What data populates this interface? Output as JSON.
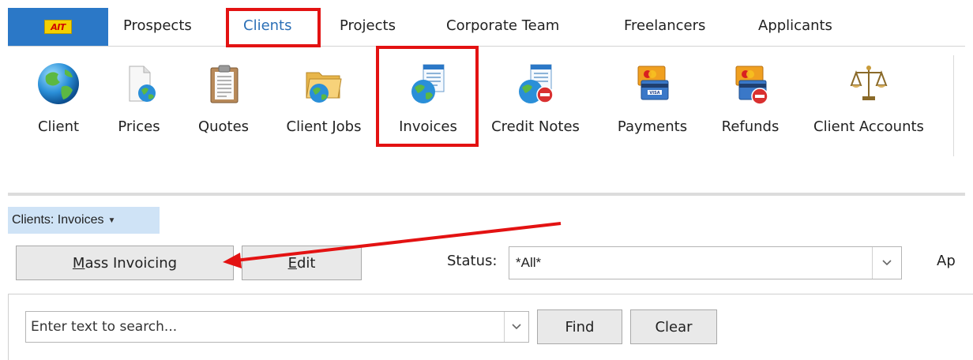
{
  "app": {
    "logo_text": "AIT"
  },
  "tabs": [
    {
      "label": "Prospects"
    },
    {
      "label": "Clients"
    },
    {
      "label": "Projects"
    },
    {
      "label": "Corporate Team"
    },
    {
      "label": "Freelancers"
    },
    {
      "label": "Applicants"
    }
  ],
  "ribbon": {
    "items": [
      {
        "label": "Client",
        "icon": "globe-icon"
      },
      {
        "label": "Prices",
        "icon": "document-globe-icon"
      },
      {
        "label": "Quotes",
        "icon": "clipboard-icon"
      },
      {
        "label": "Client Jobs",
        "icon": "folder-globe-icon"
      },
      {
        "label": "Invoices",
        "icon": "invoice-globe-icon"
      },
      {
        "label": "Credit Notes",
        "icon": "invoice-globe-minus-icon"
      },
      {
        "label": "Payments",
        "icon": "credit-cards-icon"
      },
      {
        "label": "Refunds",
        "icon": "credit-cards-minus-icon"
      },
      {
        "label": "Client Accounts",
        "icon": "scales-icon"
      }
    ]
  },
  "breadcrumb": {
    "text": "Clients: Invoices"
  },
  "toolbar": {
    "mass_invoicing": "Mass Invoicing",
    "mass_invoicing_mnemonic": "M",
    "mass_invoicing_rest": "ass Invoicing",
    "edit_mnemonic": "E",
    "edit_rest": "dit",
    "status_label": "Status:",
    "status_value": "*All*",
    "cut_label": "Ap"
  },
  "search": {
    "placeholder": "Enter text to search...",
    "find_label": "Find",
    "clear_label": "Clear"
  },
  "colors": {
    "accent": "#2b78c7",
    "highlight": "#e31212",
    "breadcrumb_bg": "#cfe3f6"
  }
}
